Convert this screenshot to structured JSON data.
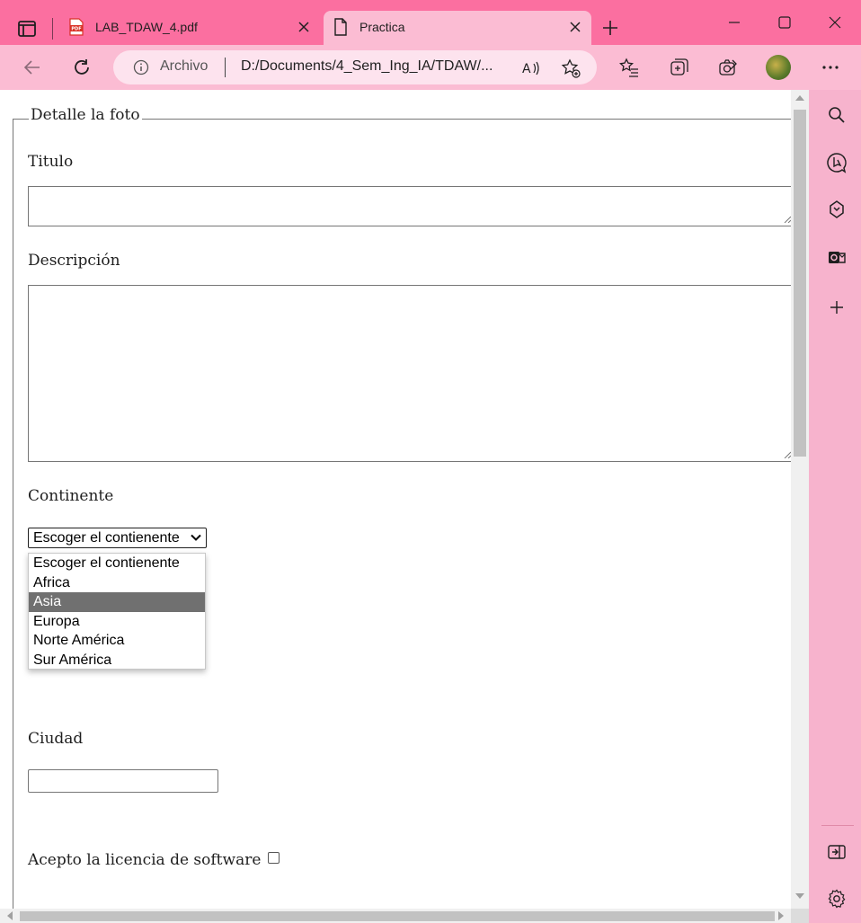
{
  "browser": {
    "tabs": [
      {
        "label": "LAB_TDAW_4.pdf",
        "active": false,
        "icon": "pdf-icon"
      },
      {
        "label": "Practica",
        "active": true,
        "icon": "page-icon"
      }
    ],
    "address": {
      "security_label": "Archivo",
      "url": "D:/Documents/4_Sem_Ing_IA/TDAW/..."
    },
    "colors": {
      "tabbar": "#fb6fa0",
      "toolbar": "#fbbcd3",
      "accent": "#f7b3cd"
    }
  },
  "form": {
    "legend": "Detalle la foto",
    "titulo_label": "Titulo",
    "titulo_value": "",
    "descripcion_label": "Descripción",
    "descripcion_value": "",
    "continente_label": "Continente",
    "continente_selected": "Escoger el contienente",
    "continente_options": [
      "Escoger el contienente",
      "Africa",
      "Asia",
      "Europa",
      "Norte América",
      "Sur América"
    ],
    "continente_highlighted": "Asia",
    "ciudad_label": "Ciudad",
    "ciudad_value": "",
    "licencia_label": "Acepto la licencia de software",
    "licencia_checked": false
  }
}
